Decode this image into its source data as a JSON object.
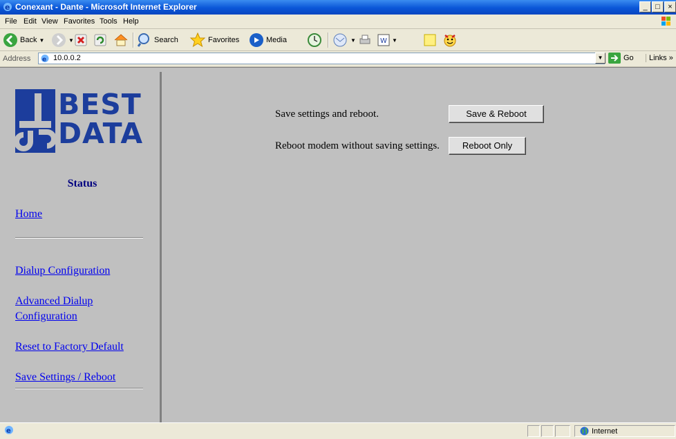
{
  "window": {
    "title": "Conexant - Dante - Microsoft Internet Explorer",
    "buttons": {
      "minimize": "_",
      "maximize": "□",
      "close": "×"
    }
  },
  "menu": [
    "File",
    "Edit",
    "View",
    "Favorites",
    "Tools",
    "Help"
  ],
  "toolbar": {
    "back": "Back",
    "search": "Search",
    "favorites": "Favorites",
    "media": "Media"
  },
  "address": {
    "label": "Address",
    "url": "10.0.0.2",
    "go": "Go",
    "links": "Links »"
  },
  "left": {
    "logo": {
      "line1": "BEST",
      "line2": "DATA",
      "color": "#1c3d9c"
    },
    "status": "Status",
    "links": {
      "home": "Home",
      "dialup": "Dialup Configuration",
      "advanced1": "Advanced Dialup",
      "advanced2": "Configuration",
      "reset": "Reset to Factory Default",
      "save": "Save Settings / Reboot"
    }
  },
  "main": {
    "save_text": "Save settings and reboot.",
    "save_button": "Save & Reboot",
    "reboot_text": "Reboot modem without saving settings.",
    "reboot_button": "Reboot Only"
  },
  "statusbar": {
    "zone": "Internet"
  }
}
